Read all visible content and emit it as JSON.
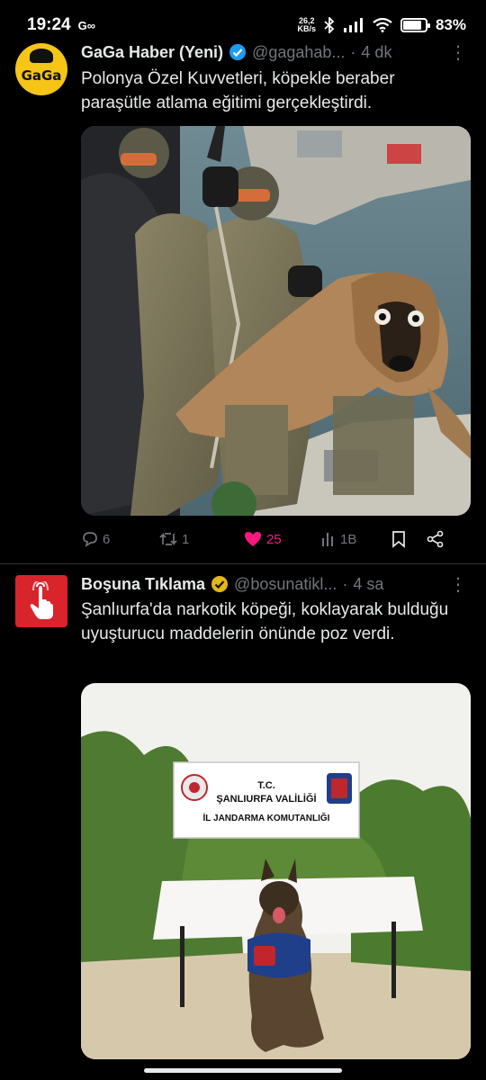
{
  "status_bar": {
    "time": "19:24",
    "app_indicator": "G∞",
    "net_speed": "26,2",
    "net_unit": "KB/s",
    "battery": "83%",
    "battery_level": 0.83
  },
  "tweets": [
    {
      "author": "GaGa Haber (Yeni)",
      "handle": "@gagahab...",
      "time": "4 dk",
      "text": "Polonya Özel Kuvvetleri, köpekle beraber paraşütle atlama eğitimi gerçekleştirdi.",
      "avatar_text": "GaGa",
      "replies": "6",
      "retweets": "1",
      "likes": "25",
      "views": "1B"
    },
    {
      "author": "Boşuna Tıklama",
      "handle": "@bosunatikl...",
      "time": "4 sa",
      "text": "Şanlıurfa'da narkotik köpeği, koklayarak bulduğu uyuşturucu maddelerin önünde poz verdi.",
      "sign_line1": "T.C.",
      "sign_line2": "ŞANLIURFA VALİLİĞİ",
      "sign_line3": "İL JANDARMA KOMUTANLIĞI"
    }
  ],
  "colors": {
    "background": "#000000",
    "text": "#e7e9ea",
    "muted": "#71767b",
    "like": "#f91880",
    "verified_blue": "#1d9bf0",
    "verified_gold": "#e2b719",
    "divider": "#2f3336"
  },
  "icons": [
    "reply-icon",
    "retweet-icon",
    "like-icon",
    "views-icon",
    "bookmark-icon",
    "share-icon",
    "verified-badge-icon",
    "more-icon",
    "wifi-icon",
    "signal-icon",
    "bluetooth-icon",
    "battery-icon"
  ]
}
